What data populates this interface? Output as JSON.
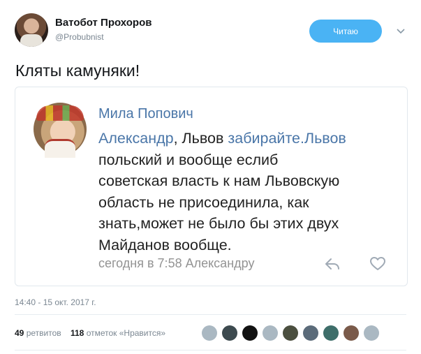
{
  "author": {
    "name": "Ватобот Прохоров",
    "handle": "@Probubnist",
    "follow_label": "Читаю"
  },
  "tweet": {
    "text": "Кляты камуняки!",
    "timestamp": "14:40 - 15 окт. 2017 г."
  },
  "embedded_post": {
    "author_name": "Мила Попович",
    "lines": [
      {
        "link_before": "Александр",
        "text": ", Львов ",
        "link_after": "забирайте.Львов"
      },
      {
        "link_before": "",
        "text": "польский и вообще еслиб",
        "link_after": ""
      },
      {
        "link_before": "",
        "text": "советская власть к нам Львовскую",
        "link_after": ""
      },
      {
        "link_before": "",
        "text": "область не присоединила, как",
        "link_after": ""
      },
      {
        "link_before": "",
        "text": "знать,может не было бы этих двух",
        "link_after": ""
      },
      {
        "link_before": "",
        "text": "Майданов вообще.",
        "link_after": ""
      }
    ],
    "meta": "сегодня в 7:58 Александру",
    "share_icon": "share-arrow-icon",
    "like_icon": "heart-icon"
  },
  "stats": {
    "retweets_count": "49",
    "retweets_label": "ретвитов",
    "likes_count": "118",
    "likes_label": "отметок «Нравится»"
  },
  "likers": [
    {
      "color": "#aab8c2"
    },
    {
      "color": "#3d4a4f"
    },
    {
      "color": "#111111"
    },
    {
      "color": "#aab8c2"
    },
    {
      "color": "#4b4f3f"
    },
    {
      "color": "#5b6b7a"
    },
    {
      "color": "#3e6e6a"
    },
    {
      "color": "#7a5a4a"
    },
    {
      "color": "#aab8c2"
    }
  ],
  "colors": {
    "accent": "#4ab3f4",
    "vk_link": "#4a76a8",
    "muted": "#7b8792"
  }
}
